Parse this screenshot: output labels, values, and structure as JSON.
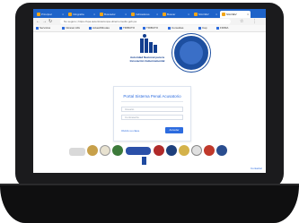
{
  "browser": {
    "tabs": [
      {
        "label": "Principal"
      },
      {
        "label": "Infografía"
      },
      {
        "label": "Buscador"
      },
      {
        "label": "Indicadores"
      },
      {
        "label": "Buscar"
      },
      {
        "label": "SIA DEV"
      },
      {
        "label": "SIA DEV",
        "active": true
      }
    ],
    "address": "No seguro | https://spa.autenticacionpa.ubiernomedio.gob.pa",
    "bookmarks": [
      {
        "label": "Servicios"
      },
      {
        "label": "Intranet AIG"
      },
      {
        "label": "Actas/Minutas"
      },
      {
        "label": "TRIBUTO"
      },
      {
        "label": "TRIBUTO"
      },
      {
        "label": "Consultas"
      },
      {
        "label": "Cap"
      },
      {
        "label": "FIRMA"
      }
    ]
  },
  "logo": {
    "name": "Autoridad Nacional para la Innovación Gubernamental"
  },
  "login": {
    "title": "Portal Sistema Penal Acusatorio",
    "username_placeholder": "Usuario",
    "password_placeholder": "Contraseña",
    "forgot_label": "Olvidó su clave",
    "login_button": "Acceder"
  },
  "footer": {
    "link": "Contactar"
  },
  "colors": {
    "browser_blue": "#1e63c9",
    "accent_blue": "#2d6cdf",
    "brand_navy": "#123e8f"
  }
}
